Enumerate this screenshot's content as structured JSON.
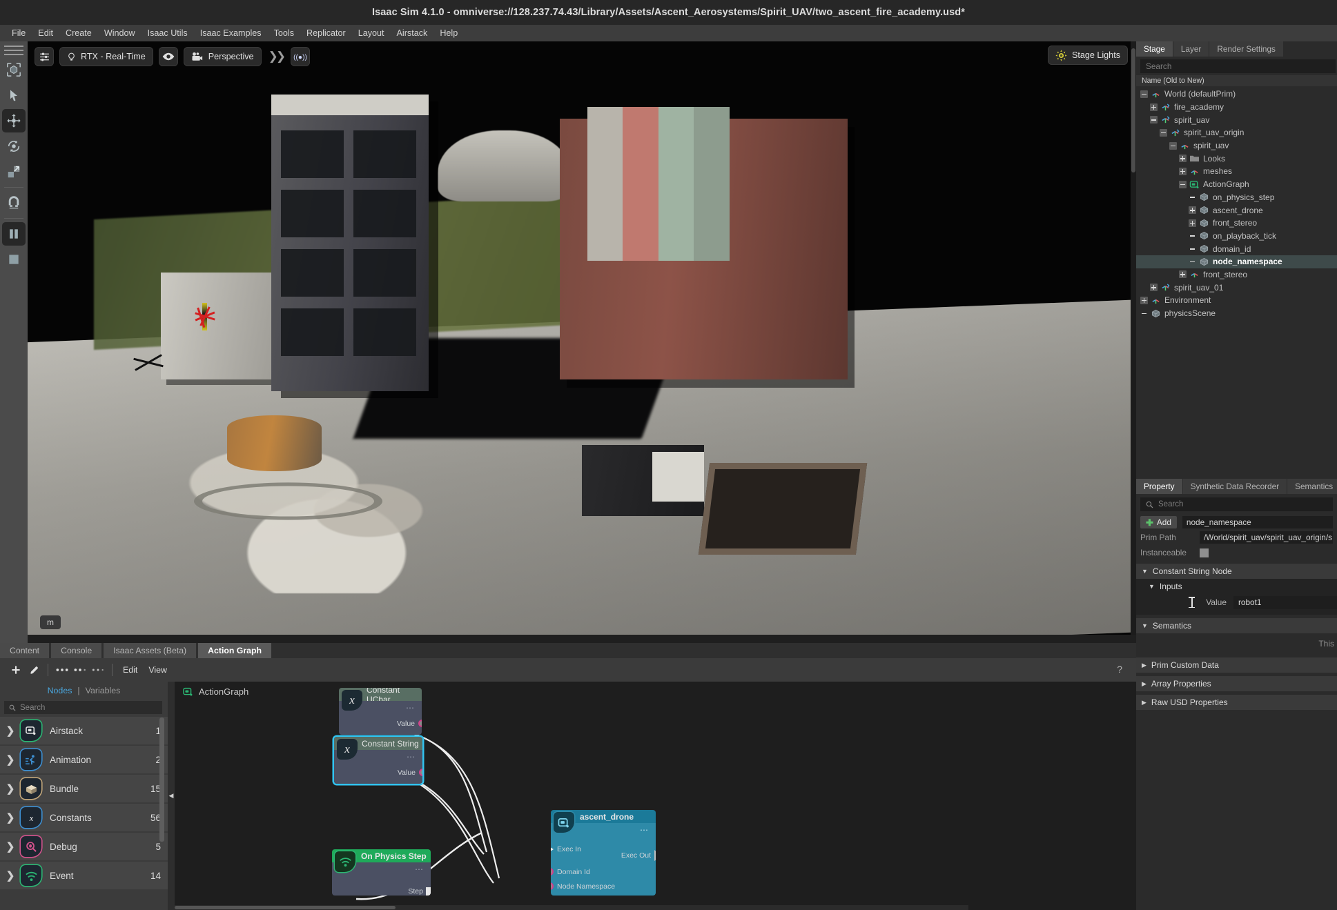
{
  "window": {
    "title": "Isaac Sim 4.1.0 - omniverse://128.237.74.43/Library/Assets/Ascent_Aerosystems/Spirit_UAV/two_ascent_fire_academy.usd*"
  },
  "menubar": {
    "items": [
      "File",
      "Edit",
      "Create",
      "Window",
      "Isaac Utils",
      "Isaac Examples",
      "Tools",
      "Replicator",
      "Layout",
      "Airstack",
      "Help"
    ]
  },
  "left_toolbar": {
    "items": [
      {
        "name": "select-bbox-tool",
        "glyph": "bbox"
      },
      {
        "name": "select-arrow-tool",
        "glyph": "arrow"
      },
      {
        "name": "move-tool",
        "glyph": "move",
        "active": true
      },
      {
        "name": "rotate-tool",
        "glyph": "rotate"
      },
      {
        "name": "scale-tool",
        "glyph": "scale"
      },
      {
        "name": "snap-tool",
        "glyph": "magnet"
      },
      {
        "name": "pause-tool",
        "glyph": "pause",
        "active": true
      },
      {
        "name": "stop-tool",
        "glyph": "stop"
      }
    ]
  },
  "viewport": {
    "settings_label": "",
    "renderer_label": "RTX - Real-Time",
    "camera_label": "Perspective",
    "lights_label": "Stage Lights",
    "unit_label": "m"
  },
  "stage": {
    "tabs": [
      "Stage",
      "Layer",
      "Render Settings"
    ],
    "active_tab": "Stage",
    "search_placeholder": "Search",
    "column_header": "Name (Old to New)",
    "tree": [
      {
        "label": "World (defaultPrim)",
        "depth": 0,
        "expander": "minus",
        "icon": "axis-icon",
        "selected": false
      },
      {
        "label": "fire_academy",
        "depth": 1,
        "expander": "plus",
        "icon": "xform-icon",
        "selected": false
      },
      {
        "label": "spirit_uav",
        "depth": 1,
        "expander": "minus",
        "icon": "xform-icon",
        "selected": false
      },
      {
        "label": "spirit_uav_origin",
        "depth": 2,
        "expander": "minus",
        "icon": "xform-icon",
        "selected": false
      },
      {
        "label": "spirit_uav",
        "depth": 3,
        "expander": "minus",
        "icon": "axis-icon",
        "selected": false
      },
      {
        "label": "Looks",
        "depth": 4,
        "expander": "plus",
        "icon": "folder-icon",
        "selected": false
      },
      {
        "label": "meshes",
        "depth": 4,
        "expander": "plus",
        "icon": "axis-icon",
        "selected": false
      },
      {
        "label": "ActionGraph",
        "depth": 4,
        "expander": "minus",
        "icon": "graph-icon",
        "selected": false
      },
      {
        "label": "on_physics_step",
        "depth": 5,
        "expander": "none",
        "icon": "cube-icon",
        "selected": false
      },
      {
        "label": "ascent_drone",
        "depth": 5,
        "expander": "plus",
        "icon": "cube-icon",
        "selected": false
      },
      {
        "label": "front_stereo",
        "depth": 5,
        "expander": "plus",
        "icon": "cube-icon",
        "selected": false
      },
      {
        "label": "on_playback_tick",
        "depth": 5,
        "expander": "none",
        "icon": "cube-icon",
        "selected": false
      },
      {
        "label": "domain_id",
        "depth": 5,
        "expander": "none",
        "icon": "cube-icon",
        "selected": false
      },
      {
        "label": "node_namespace",
        "depth": 5,
        "expander": "none",
        "icon": "cube-icon",
        "selected": true
      },
      {
        "label": "front_stereo",
        "depth": 4,
        "expander": "plus",
        "icon": "axis-icon",
        "selected": false
      },
      {
        "label": "spirit_uav_01",
        "depth": 1,
        "expander": "plus",
        "icon": "xform-icon",
        "selected": false
      },
      {
        "label": "Environment",
        "depth": 0,
        "expander": "plus",
        "icon": "axis-icon",
        "selected": false
      },
      {
        "label": "physicsScene",
        "depth": 0,
        "expander": "none",
        "icon": "cube-icon",
        "selected": false
      }
    ]
  },
  "property": {
    "tabs": [
      "Property",
      "Synthetic Data Recorder",
      "Semantics"
    ],
    "active_tab": "Property",
    "search_placeholder": "Search",
    "add_label": "Add",
    "prim_name": "node_namespace",
    "prim_path_label": "Prim Path",
    "prim_path_value": "/World/spirit_uav/spirit_uav_origin/s",
    "instanceable_label": "Instanceable",
    "sections": [
      {
        "label": "Constant String Node",
        "open": true
      },
      {
        "label": "Inputs",
        "open": true
      },
      {
        "label": "Semantics",
        "open": true
      },
      {
        "label": "Prim Custom Data",
        "open": false
      },
      {
        "label": "Array Properties",
        "open": false
      },
      {
        "label": "Raw USD Properties",
        "open": false
      }
    ],
    "value_label": "Value",
    "value_text": "robot1",
    "semantics_hint": "This"
  },
  "bottom": {
    "tabs": [
      "Content",
      "Console",
      "Isaac Assets (Beta)",
      "Action Graph"
    ],
    "active_tab": "Action Graph",
    "toolbar": {
      "add_icon": "plus-icon",
      "edit_icon": "pencil-icon",
      "edit_label": "Edit",
      "view_label": "View",
      "help_label": "?"
    },
    "node_panel": {
      "tab_nodes": "Nodes",
      "tab_sep": "|",
      "tab_variables": "Variables",
      "search_placeholder": "Search",
      "categories": [
        {
          "name": "Airstack",
          "count": "1",
          "color": "#2bb673",
          "icon": "graph-icon"
        },
        {
          "name": "Animation",
          "count": "2",
          "color": "#3d8fd1",
          "icon": "runner-icon"
        },
        {
          "name": "Bundle",
          "count": "15",
          "color": "#c3a77a",
          "icon": "box-icon"
        },
        {
          "name": "Constants",
          "count": "56",
          "color": "#3d8fd1",
          "icon": "x-italic-icon"
        },
        {
          "name": "Debug",
          "count": "5",
          "color": "#d2528c",
          "icon": "bug-magnifier-icon"
        },
        {
          "name": "Event",
          "count": "14",
          "color": "#2bb673",
          "icon": "wifi-icon"
        }
      ]
    },
    "graph": {
      "title": "ActionGraph",
      "nodes": [
        {
          "id": "constant_uchar",
          "title": "Constant UChar",
          "icon": "x-italic-icon",
          "selected": false,
          "outputs": [
            "Value"
          ],
          "inputs": []
        },
        {
          "id": "constant_string",
          "title": "Constant String",
          "icon": "x-italic-icon",
          "selected": true,
          "outputs": [
            "Value"
          ],
          "inputs": []
        },
        {
          "id": "on_physics_step",
          "title": "On Physics Step",
          "icon": "wifi-icon",
          "selected": false,
          "outputs": [
            "Step"
          ],
          "inputs": []
        },
        {
          "id": "ascent_drone",
          "title": "ascent_drone",
          "icon": "graph-icon",
          "selected": false,
          "inputs": [
            "Exec In",
            "Domain Id",
            "Node Namespace"
          ],
          "outputs": [
            "Exec Out"
          ]
        }
      ]
    }
  }
}
